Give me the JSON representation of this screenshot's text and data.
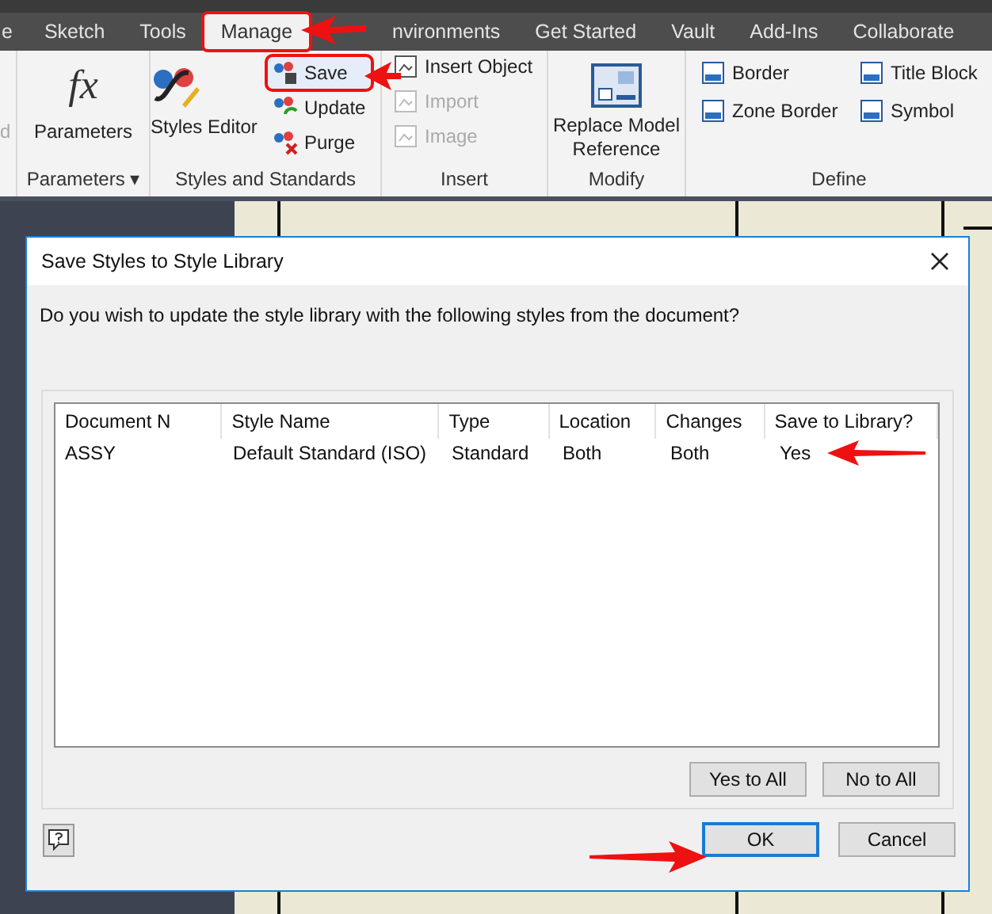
{
  "ribbon_tabs": [
    {
      "label": "e",
      "selected": false,
      "highlighted": false
    },
    {
      "label": "Sketch",
      "selected": false,
      "highlighted": false
    },
    {
      "label": "Tools",
      "selected": false,
      "highlighted": false
    },
    {
      "label": "Manage",
      "selected": true,
      "highlighted": true
    },
    {
      "label": "nvironments",
      "selected": false,
      "highlighted": false
    },
    {
      "label": "Get Started",
      "selected": false,
      "highlighted": false
    },
    {
      "label": "Vault",
      "selected": false,
      "highlighted": false
    },
    {
      "label": "Add-Ins",
      "selected": false,
      "highlighted": false
    },
    {
      "label": "Collaborate",
      "selected": false,
      "highlighted": false
    }
  ],
  "ribbon": {
    "cut_panel": {
      "label": "d"
    },
    "parameters": {
      "icon_text": "fx",
      "button": "Parameters",
      "footer": "Parameters",
      "footer_caret": "▾"
    },
    "styles": {
      "big_button": "Styles Editor",
      "buttons": [
        {
          "label": "Save",
          "kind": "save",
          "highlighted": true
        },
        {
          "label": "Update",
          "kind": "update",
          "highlighted": false
        },
        {
          "label": "Purge",
          "kind": "purge",
          "highlighted": false
        }
      ],
      "footer": "Styles and Standards"
    },
    "insert": {
      "buttons": [
        {
          "label": "Insert Object",
          "disabled": false
        },
        {
          "label": "Import",
          "disabled": true
        },
        {
          "label": "Image",
          "disabled": true
        }
      ],
      "footer": "Insert"
    },
    "modify": {
      "button_lines": [
        "Replace Model",
        "Reference"
      ],
      "footer": "Modify"
    },
    "define": {
      "buttons": [
        "Border",
        "Zone Border",
        "Title Block",
        "Symbol"
      ],
      "footer": "Define"
    }
  },
  "dialog": {
    "title": "Save Styles to Style Library",
    "message": "Do you wish to update the style library with the following styles from the document?",
    "table": {
      "columns": [
        "Document N",
        "Style Name",
        "Type",
        "Location",
        "Changes",
        "Save to Library?"
      ],
      "rows": [
        [
          "ASSY",
          "Default Standard (ISO)",
          "Standard",
          "Both",
          "Both",
          "Yes"
        ]
      ]
    },
    "list_buttons": [
      "Yes to All",
      "No to All"
    ],
    "buttons": [
      {
        "label": "OK",
        "default": true
      },
      {
        "label": "Cancel",
        "default": false
      }
    ]
  }
}
